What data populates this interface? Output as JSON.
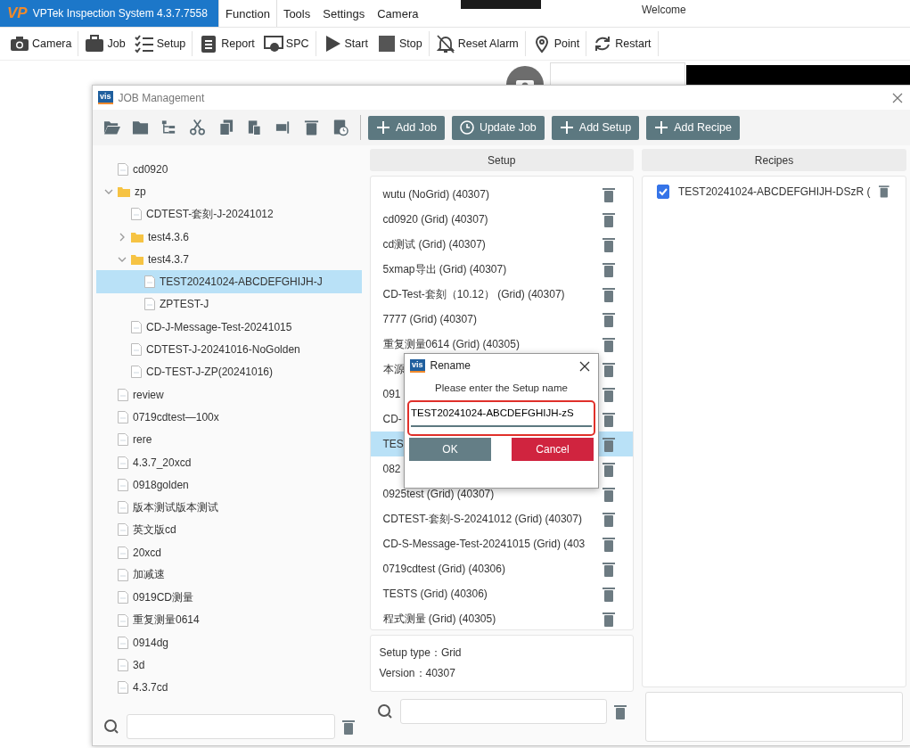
{
  "app": {
    "logo": "VP",
    "title": "VPTek Inspection System 4.3.7.7558",
    "welcome": "Welcome",
    "menu": [
      {
        "label": "Function",
        "selected": true
      },
      {
        "label": "Tools",
        "selected": false
      },
      {
        "label": "Settings",
        "selected": false
      },
      {
        "label": "Camera",
        "selected": false
      }
    ],
    "toolbar": [
      "Camera",
      "Job",
      "Setup",
      "Report",
      "SPC",
      "Start",
      "Stop",
      "Reset Alarm",
      "Point",
      "Restart"
    ]
  },
  "job_window": {
    "logo": "vis",
    "title": "JOB Management",
    "action_buttons": [
      "Add Job",
      "Update Job",
      "Add Setup",
      "Add Recipe"
    ],
    "tree": [
      {
        "kind": "file",
        "label": "cd0920",
        "selected": false
      },
      {
        "kind": "folder",
        "label": "zp",
        "expanded": true,
        "selected": false,
        "children": [
          {
            "kind": "file",
            "label": "CDTEST-套刻-J-20241012",
            "selected": false
          },
          {
            "kind": "folder",
            "label": "test4.3.6",
            "expanded": false,
            "selected": false
          },
          {
            "kind": "folder",
            "label": "test4.3.7",
            "expanded": true,
            "selected": false,
            "children": [
              {
                "kind": "file",
                "label": "TEST20241024-ABCDEFGHIJH-J",
                "selected": true
              },
              {
                "kind": "file",
                "label": "ZPTEST-J",
                "selected": false
              }
            ]
          },
          {
            "kind": "file",
            "label": "CD-J-Message-Test-20241015",
            "selected": false
          },
          {
            "kind": "file",
            "label": "CDTEST-J-20241016-NoGolden",
            "selected": false
          },
          {
            "kind": "file",
            "label": "CD-TEST-J-ZP(20241016)",
            "selected": false
          }
        ]
      },
      {
        "kind": "file",
        "label": "review",
        "selected": false
      },
      {
        "kind": "file",
        "label": "0719cdtest—100x",
        "selected": false
      },
      {
        "kind": "file",
        "label": "rere",
        "selected": false
      },
      {
        "kind": "file",
        "label": "4.3.7_20xcd",
        "selected": false
      },
      {
        "kind": "file",
        "label": "0918golden",
        "selected": false
      },
      {
        "kind": "file",
        "label": "版本测试版本测试",
        "selected": false
      },
      {
        "kind": "file",
        "label": "英文版cd",
        "selected": false
      },
      {
        "kind": "file",
        "label": "20xcd",
        "selected": false
      },
      {
        "kind": "file",
        "label": "加减速",
        "selected": false
      },
      {
        "kind": "file",
        "label": "0919CD测量",
        "selected": false
      },
      {
        "kind": "file",
        "label": "重复测量0614",
        "selected": false
      },
      {
        "kind": "file",
        "label": "0914dg",
        "selected": false
      },
      {
        "kind": "file",
        "label": "3d",
        "selected": false
      },
      {
        "kind": "file",
        "label": "4.3.7cd",
        "selected": false
      }
    ],
    "setup_heading": "Setup",
    "setups": [
      {
        "text": "wutu  (NoGrid) (40307)",
        "selected": false
      },
      {
        "text": "cd0920 (Grid) (40307)",
        "selected": false
      },
      {
        "text": "cd测试 (Grid) (40307)",
        "selected": false
      },
      {
        "text": "5xmap导出 (Grid) (40307)",
        "selected": false
      },
      {
        "text": "CD-Test-套刻（10.12） (Grid) (40307)",
        "selected": false
      },
      {
        "text": "7777 (Grid) (40307)",
        "selected": false
      },
      {
        "text": "重复测量0614 (Grid) (40305)",
        "selected": false
      },
      {
        "text": "本源",
        "selected": false
      },
      {
        "text": "091",
        "selected": false
      },
      {
        "text": "CD-",
        "selected": false
      },
      {
        "text": "TES",
        "selected": true
      },
      {
        "text": "082",
        "selected": false
      },
      {
        "text": "0925test (Grid) (40307)",
        "selected": false
      },
      {
        "text": "CDTEST-套刻-S-20241012 (Grid) (40307)",
        "selected": false
      },
      {
        "text": "CD-S-Message-Test-20241015 (Grid) (403",
        "selected": false
      },
      {
        "text": "0719cdtest (Grid) (40306)",
        "selected": false
      },
      {
        "text": "TESTS (Grid) (40306)",
        "selected": false
      },
      {
        "text": "程式测量 (Grid) (40305)",
        "selected": false
      }
    ],
    "setup_info": [
      "Setup type：Grid",
      "Version：40307"
    ],
    "recipes_heading": "Recipes",
    "recipes": [
      {
        "text": "TEST20241024-ABCDEFGHIJH-DSzR (",
        "checked": true
      }
    ]
  },
  "rename_dialog": {
    "logo": "vis",
    "title": "Rename",
    "prompt": "Please enter the Setup name",
    "value": "TEST20241024-ABCDEFGHIJH-zS",
    "highlighted": true,
    "ok": "OK",
    "cancel": "Cancel"
  }
}
